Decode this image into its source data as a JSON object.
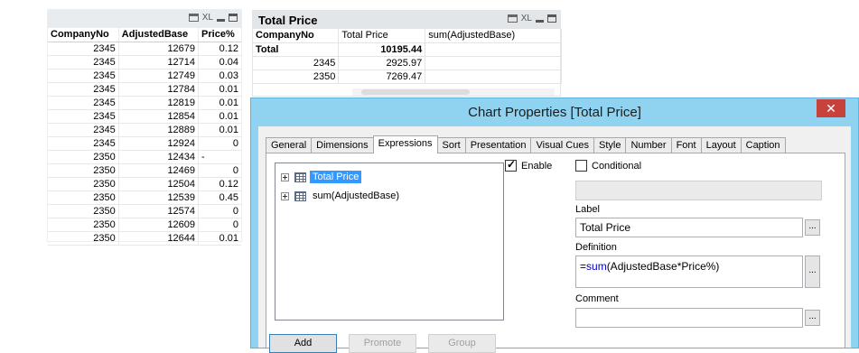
{
  "left_table": {
    "caption_icons": {
      "print": "printer-icon",
      "xl": "XL",
      "minimize": "minimize-icon",
      "maximize": "maximize-icon"
    },
    "headers": [
      "CompanyNo",
      "AdjustedBase",
      "Price%"
    ],
    "rows": [
      [
        "2345",
        "12679",
        "0.12"
      ],
      [
        "2345",
        "12714",
        "0.04"
      ],
      [
        "2345",
        "12749",
        "0.03"
      ],
      [
        "2345",
        "12784",
        "0.01"
      ],
      [
        "2345",
        "12819",
        "0.01"
      ],
      [
        "2345",
        "12854",
        "0.01"
      ],
      [
        "2345",
        "12889",
        "0.01"
      ],
      [
        "2345",
        "12924",
        "0"
      ],
      [
        "2350",
        "12434",
        "-"
      ],
      [
        "2350",
        "12469",
        "0"
      ],
      [
        "2350",
        "12504",
        "0.12"
      ],
      [
        "2350",
        "12539",
        "0.45"
      ],
      [
        "2350",
        "12574",
        "0"
      ],
      [
        "2350",
        "12609",
        "0"
      ],
      [
        "2350",
        "12644",
        "0.01"
      ]
    ]
  },
  "total_price_chart": {
    "title": "Total Price",
    "caption_icons": {
      "print": "printer-icon",
      "xl": "XL",
      "minimize": "minimize-icon",
      "maximize": "maximize-icon"
    },
    "headers": [
      "CompanyNo",
      "Total Price",
      "sum(AdjustedBase)"
    ],
    "total_row": [
      "Total",
      "10195.44",
      ""
    ],
    "rows": [
      [
        "2345",
        "2925.97",
        ""
      ],
      [
        "2350",
        "7269.47",
        ""
      ]
    ]
  },
  "dialog": {
    "title": "Chart Properties [Total Price]",
    "close_label": "✕",
    "tabs": [
      "General",
      "Dimensions",
      "Expressions",
      "Sort",
      "Presentation",
      "Visual Cues",
      "Style",
      "Number",
      "Font",
      "Layout",
      "Caption"
    ],
    "active_tab": "Expressions",
    "expressions": [
      "Total Price",
      "sum(AdjustedBase)"
    ],
    "enable_label": "Enable",
    "enable_checked": true,
    "conditional_label": "Conditional",
    "conditional_checked": false,
    "label_caption": "Label",
    "label_value": "Total Price",
    "definition_caption": "Definition",
    "definition_prefix": "=",
    "definition_fn": "sum",
    "definition_args": "(AdjustedBase*Price%)",
    "comment_caption": "Comment",
    "comment_value": "",
    "ellipsis": "...",
    "buttons": {
      "add": "Add",
      "promote": "Promote",
      "group": "Group"
    }
  }
}
